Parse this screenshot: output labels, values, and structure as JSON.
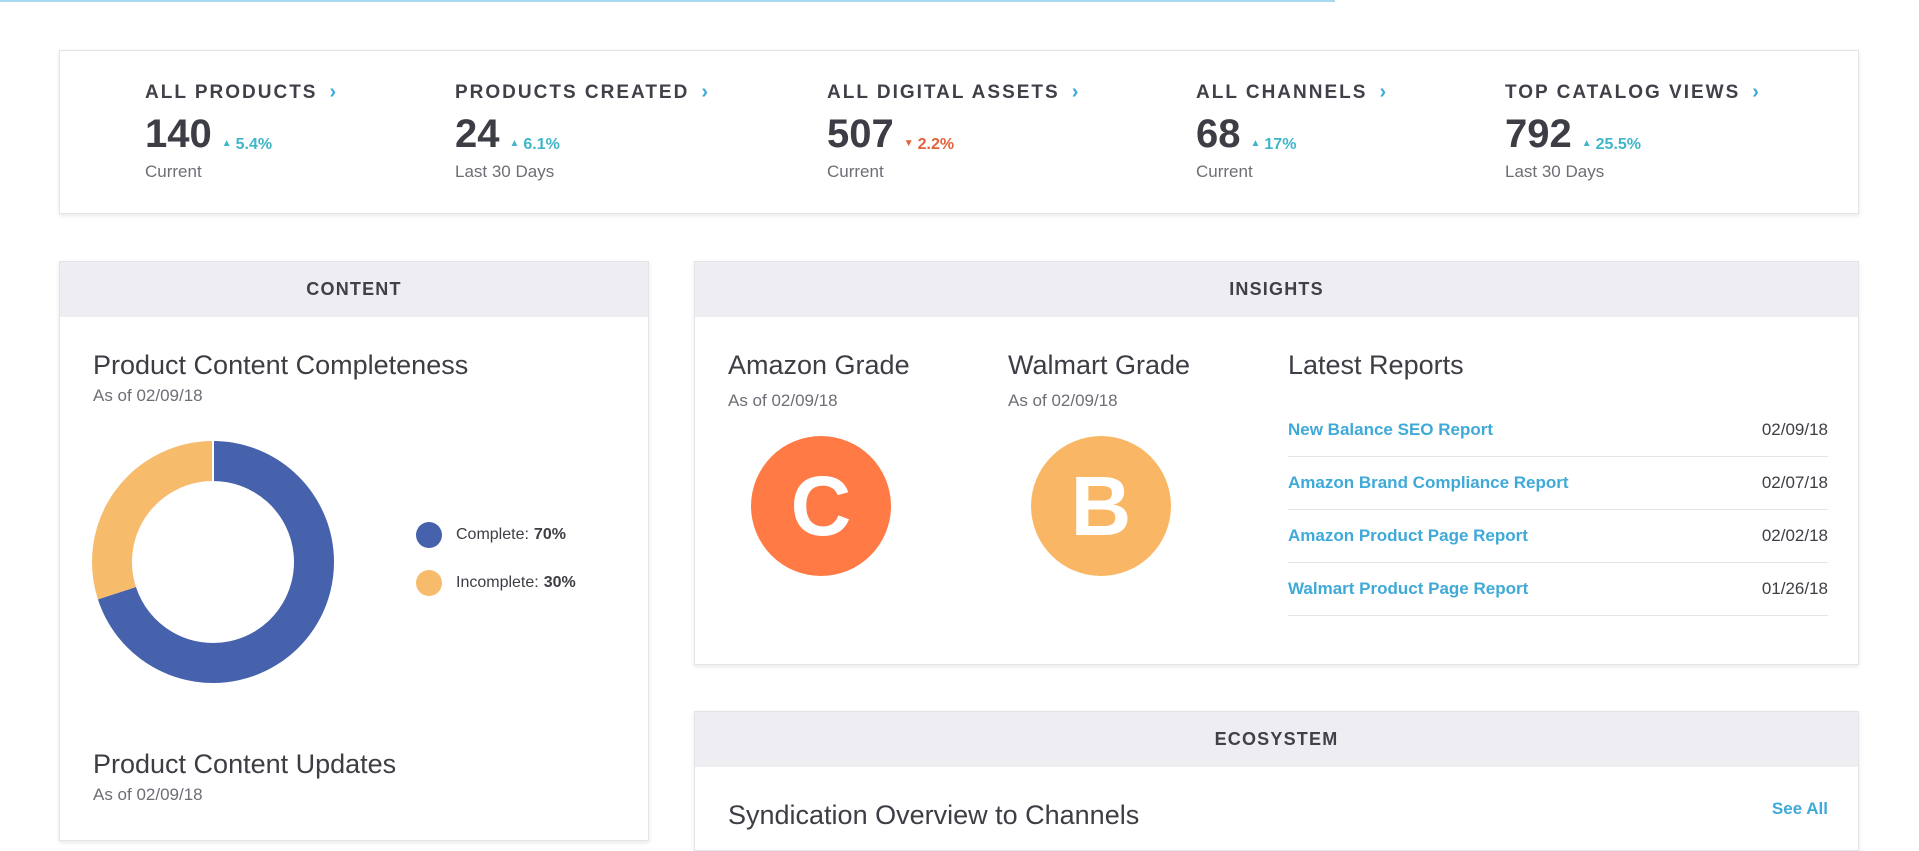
{
  "stats": [
    {
      "title": "ALL PRODUCTS",
      "value": "140",
      "change": "5.4%",
      "direction": "up",
      "sub": "Current"
    },
    {
      "title": "PRODUCTS CREATED",
      "value": "24",
      "change": "6.1%",
      "direction": "up",
      "sub": "Last 30 Days"
    },
    {
      "title": "ALL DIGITAL ASSETS",
      "value": "507",
      "change": "2.2%",
      "direction": "down",
      "sub": "Current"
    },
    {
      "title": "ALL CHANNELS",
      "value": "68",
      "change": "17%",
      "direction": "up",
      "sub": "Current"
    },
    {
      "title": "TOP CATALOG VIEWS",
      "value": "792",
      "change": "25.5%",
      "direction": "up",
      "sub": "Last 30 Days"
    }
  ],
  "icons": {
    "chevron": "chevron-right-icon",
    "up": "triangle-up-icon",
    "down": "triangle-down-icon"
  },
  "content": {
    "header": "CONTENT",
    "completeness_title": "Product Content Completeness",
    "completeness_sub": "As of 02/09/18",
    "legend": [
      {
        "label": "Complete:",
        "value": "70%",
        "color": "#4762ad"
      },
      {
        "label": "Incomplete:",
        "value": "30%",
        "color": "#f6bc6c"
      }
    ],
    "updates_title": "Product Content Updates",
    "updates_sub": "As of 02/09/18"
  },
  "chart_data": {
    "type": "pie",
    "categories": [
      "Complete",
      "Incomplete"
    ],
    "values": [
      70,
      30
    ],
    "colors": [
      "#4762ad",
      "#f6bc6c"
    ]
  },
  "insights": {
    "header": "INSIGHTS",
    "amazon": {
      "title": "Amazon Grade",
      "sub": "As of 02/09/18",
      "grade": "C",
      "color": "#ff7a45"
    },
    "walmart": {
      "title": "Walmart Grade",
      "sub": "As of 02/09/18",
      "grade": "B",
      "color": "#f9b765"
    },
    "reports_title": "Latest Reports",
    "reports": [
      {
        "name": "New Balance SEO Report",
        "date": "02/09/18"
      },
      {
        "name": "Amazon Brand Compliance Report",
        "date": "02/07/18"
      },
      {
        "name": "Amazon Product Page Report",
        "date": "02/02/18"
      },
      {
        "name": "Walmart Product Page Report",
        "date": "01/26/18"
      }
    ]
  },
  "ecosystem": {
    "header": "ECOSYSTEM",
    "title": "Syndication Overview to Channels",
    "see_all": "See All"
  }
}
